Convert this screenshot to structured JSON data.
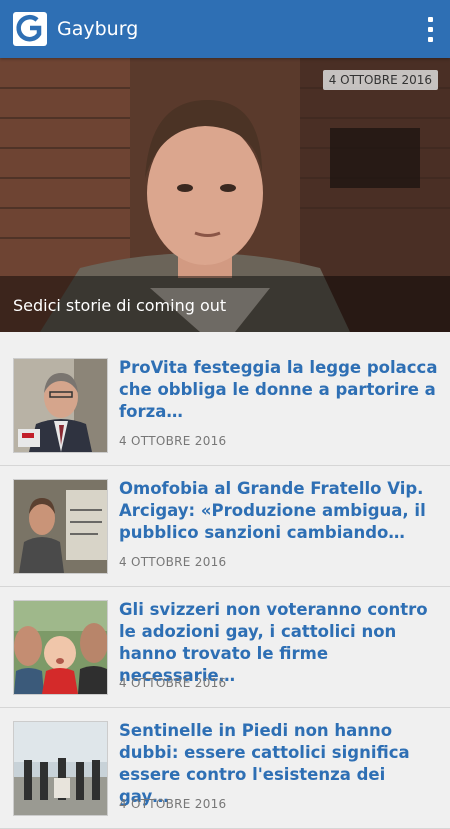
{
  "app": {
    "title": "Gayburg",
    "logo_letter": "G"
  },
  "hero": {
    "date": "4 OTTOBRE 2016",
    "caption": "Sedici storie di coming out"
  },
  "articles": [
    {
      "title": "ProVita festeggia la legge polacca che obbliga le donne a partorire a forza…",
      "date": "4 OTTOBRE 2016"
    },
    {
      "title": "Omofobia al Grande Fratello Vip. Arcigay: «Produzione ambigua, il pubblico sanzioni cambiando…",
      "date": "4 OTTOBRE 2016"
    },
    {
      "title": "Gli svizzeri non voteranno contro le adozioni gay, i cattolici non hanno trovato le firme necessarie…",
      "date": "4 OTTOBRE 2016"
    },
    {
      "title": "Sentinelle in Piedi non hanno dubbi: essere cattolici significa essere contro l'esistenza dei gay…",
      "date": "4 OTTOBRE 2016"
    }
  ],
  "colors": {
    "primary": "#2e6fb4",
    "background": "#f0f0f0",
    "date_text": "#777777"
  },
  "icons": {
    "logo": "gayburg-logo-icon",
    "menu": "overflow-menu-icon"
  }
}
